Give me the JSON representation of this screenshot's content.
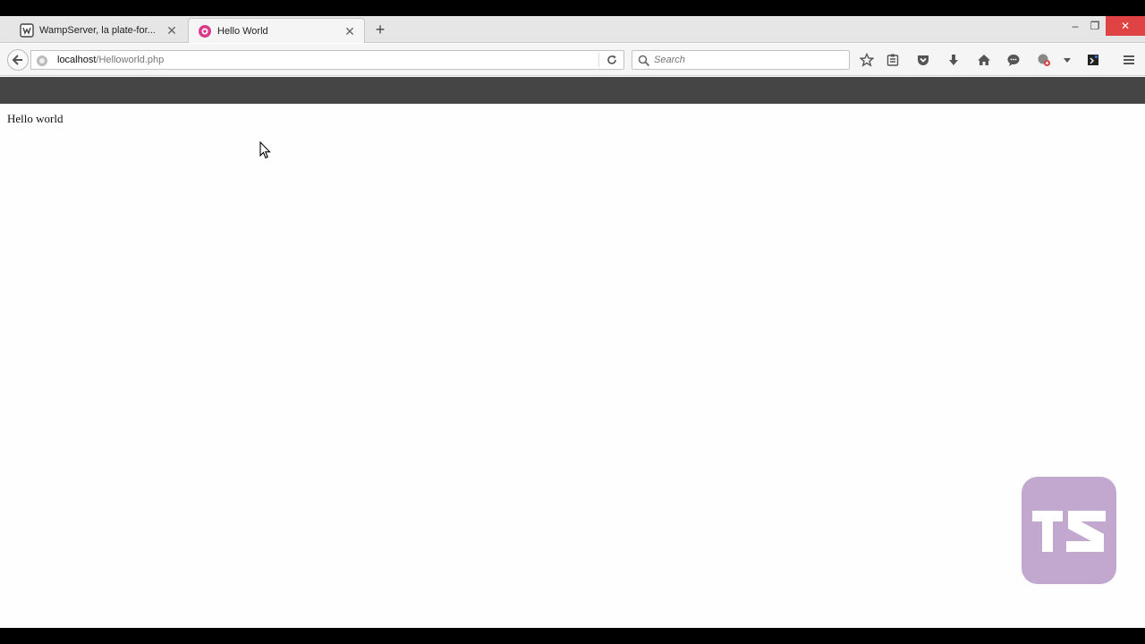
{
  "browser": {
    "tabs": [
      {
        "title": "WampServer, la plate-for...",
        "active": false,
        "favicon": "wampserver-icon"
      },
      {
        "title": "Hello World",
        "active": true,
        "favicon": "pink-flower-icon"
      }
    ],
    "new_tab_label": "+",
    "url_host": "localhost",
    "url_path": "/Helloworld.php",
    "search_placeholder": "Search",
    "window_controls": {
      "minimize": "–",
      "maximize": "❐",
      "close": "✕"
    }
  },
  "page": {
    "text": "Hello world"
  },
  "watermark": {
    "text": "TS",
    "color": "#c2a8cf"
  }
}
